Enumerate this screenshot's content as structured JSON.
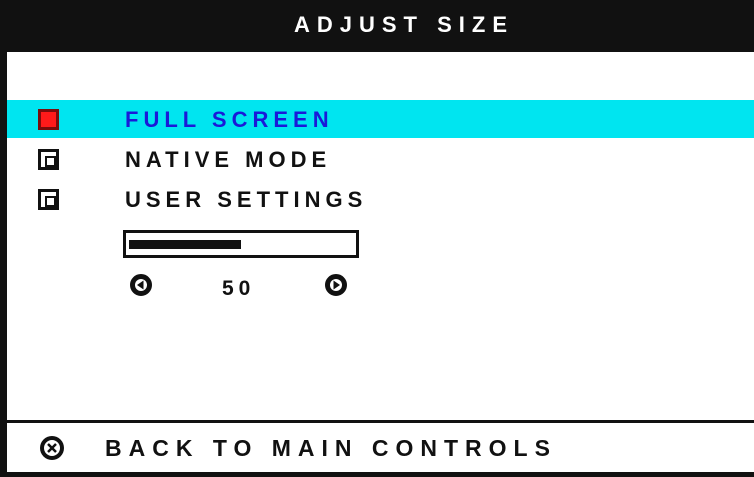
{
  "title": "ADJUST SIZE",
  "menu": {
    "items": [
      {
        "label": "FULL SCREEN",
        "selected": true,
        "checked": true
      },
      {
        "label": "NATIVE MODE",
        "selected": false,
        "checked": false
      },
      {
        "label": "USER SETTINGS",
        "selected": false,
        "checked": false
      }
    ]
  },
  "slider": {
    "value": "50",
    "min": 0,
    "max": 100,
    "left_icon": "left-arrow-icon",
    "right_icon": "right-arrow-icon"
  },
  "footer": {
    "back_label": "BACK TO MAIN CONTROLS",
    "back_icon": "exit-icon"
  },
  "colors": {
    "title_bg": "#111111",
    "highlight": "#00e5f0",
    "selected_text": "#1a1ad8",
    "checked_fill": "#ff1a1a"
  }
}
